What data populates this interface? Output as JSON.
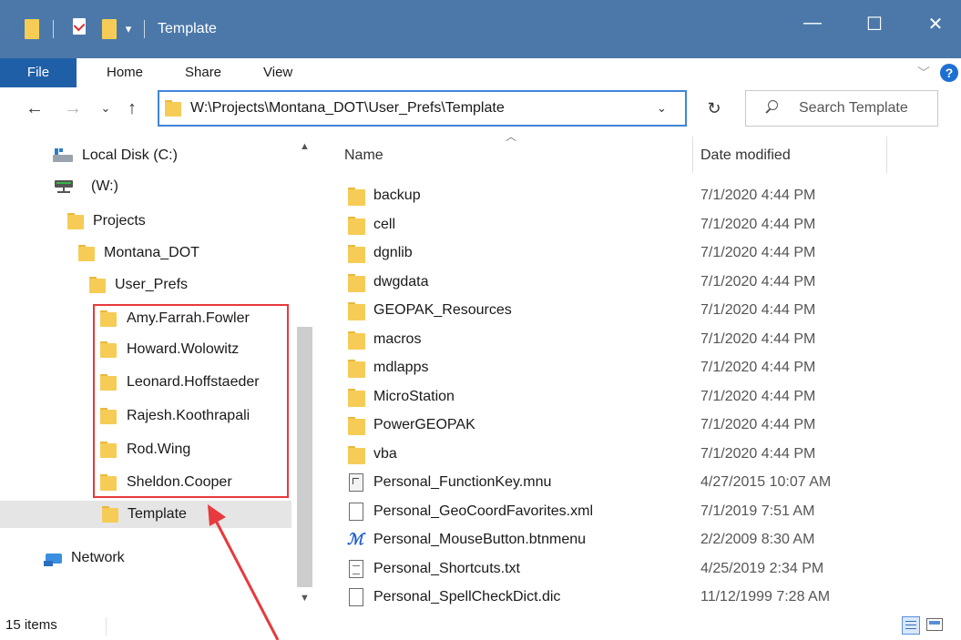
{
  "window": {
    "title": "Template",
    "controls": {
      "minimize": "—",
      "maximize": "☐",
      "close": "✕"
    },
    "accent_color": "#4b78a8"
  },
  "ribbon": {
    "file": "File",
    "tabs": [
      "Home",
      "Share",
      "View"
    ],
    "expand_icon": "chevron-down-icon",
    "help_icon": "help-icon"
  },
  "address": {
    "path": "W:\\Projects\\Montana_DOT\\User_Prefs\\Template",
    "search_placeholder": "Search Template"
  },
  "nav": {
    "items": [
      {
        "label": "Local Disk (C:)",
        "icon": "drive-icon"
      },
      {
        "label": "(W:)",
        "icon": "network-drive-icon"
      },
      {
        "label": "Projects",
        "icon": "folder-icon"
      },
      {
        "label": "Montana_DOT",
        "icon": "folder-icon"
      },
      {
        "label": "User_Prefs",
        "icon": "folder-icon"
      },
      {
        "label": "Amy.Farrah.Fowler",
        "icon": "folder-icon"
      },
      {
        "label": "Howard.Wolowitz",
        "icon": "folder-icon"
      },
      {
        "label": "Leonard.Hoffstaeder",
        "icon": "folder-icon"
      },
      {
        "label": "Rajesh.Koothrapali",
        "icon": "folder-icon"
      },
      {
        "label": "Rod.Wing",
        "icon": "folder-icon"
      },
      {
        "label": "Sheldon.Cooper",
        "icon": "folder-icon"
      },
      {
        "label": "Template",
        "icon": "folder-icon",
        "selected": true
      },
      {
        "label": "Network",
        "icon": "network-icon"
      }
    ]
  },
  "list": {
    "headers": {
      "name": "Name",
      "date": "Date modified"
    },
    "files": [
      {
        "name": "backup",
        "date": "7/1/2020 4:44 PM",
        "type": "folder"
      },
      {
        "name": "cell",
        "date": "7/1/2020 4:44 PM",
        "type": "folder"
      },
      {
        "name": "dgnlib",
        "date": "7/1/2020 4:44 PM",
        "type": "folder"
      },
      {
        "name": "dwgdata",
        "date": "7/1/2020 4:44 PM",
        "type": "folder"
      },
      {
        "name": "GEOPAK_Resources",
        "date": "7/1/2020 4:44 PM",
        "type": "folder"
      },
      {
        "name": "macros",
        "date": "7/1/2020 4:44 PM",
        "type": "folder"
      },
      {
        "name": "mdlapps",
        "date": "7/1/2020 4:44 PM",
        "type": "folder"
      },
      {
        "name": "MicroStation",
        "date": "7/1/2020 4:44 PM",
        "type": "folder"
      },
      {
        "name": "PowerGEOPAK",
        "date": "7/1/2020 4:44 PM",
        "type": "folder"
      },
      {
        "name": "vba",
        "date": "7/1/2020 4:44 PM",
        "type": "folder"
      },
      {
        "name": "Personal_FunctionKey.mnu",
        "date": "4/27/2015 10:07 AM",
        "type": "mnu"
      },
      {
        "name": "Personal_GeoCoordFavorites.xml",
        "date": "7/1/2019 7:51 AM",
        "type": "file"
      },
      {
        "name": "Personal_MouseButton.btnmenu",
        "date": "2/2/2009 8:30 AM",
        "type": "btnmenu"
      },
      {
        "name": "Personal_Shortcuts.txt",
        "date": "4/25/2019 2:34 PM",
        "type": "txt"
      },
      {
        "name": "Personal_SpellCheckDict.dic",
        "date": "11/12/1999 7:28 AM",
        "type": "file"
      }
    ]
  },
  "status": {
    "count": "15 items"
  },
  "annotation": {
    "highlight_color": "#e8393c"
  }
}
